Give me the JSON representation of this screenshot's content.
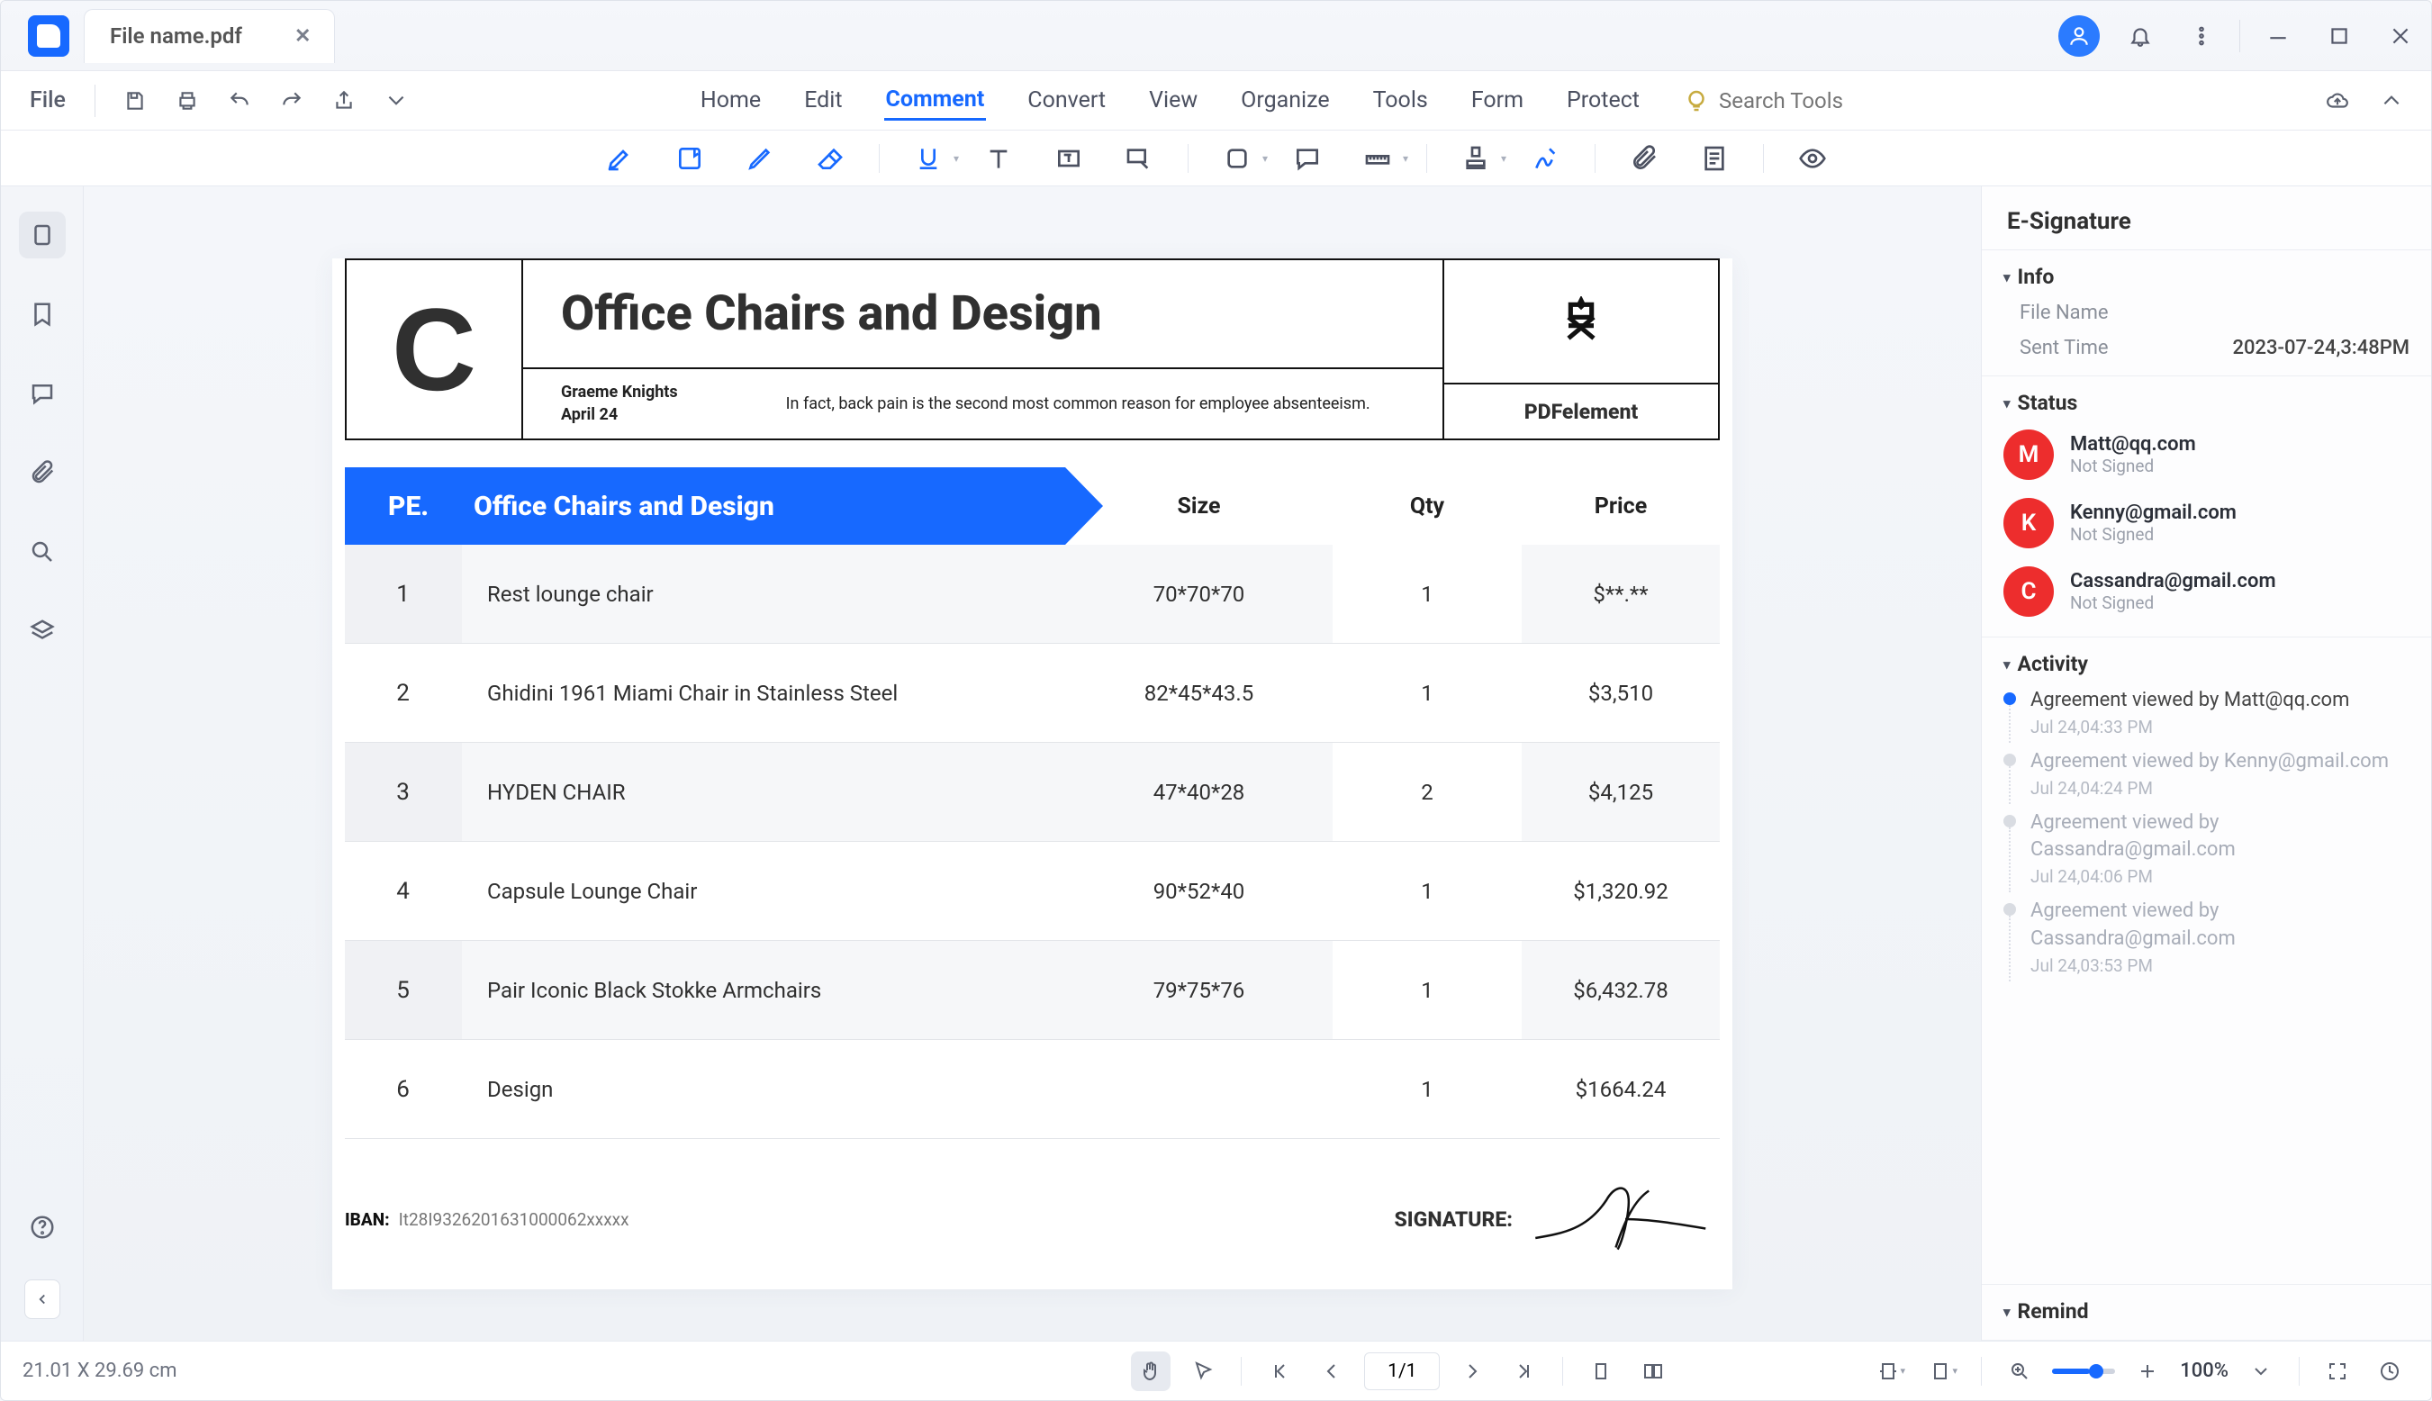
{
  "header": {
    "filename": "File name.pdf",
    "file_menu": "File"
  },
  "nav_items": [
    "Home",
    "Edit",
    "Comment",
    "Convert",
    "View",
    "Organize",
    "Tools",
    "Form",
    "Protect"
  ],
  "nav_active": "Comment",
  "search": {
    "placeholder": "Search Tools"
  },
  "leftbar_icons": [
    "thumbnails",
    "bookmarks",
    "comments",
    "attachments",
    "search",
    "layers"
  ],
  "document": {
    "title": "Office Chairs and Design",
    "author": "Graeme Knights",
    "date": "April 24",
    "subtitle": "In fact, back pain is the second most common reason for employee absenteeism.",
    "brand": "PDFelement",
    "pe_label": "PE.",
    "col_headers": {
      "size": "Size",
      "qty": "Qty",
      "price": "Price"
    },
    "rows": [
      {
        "no": "1",
        "name": "Rest lounge chair",
        "size": "70*70*70",
        "qty": "1",
        "price": "$**.**"
      },
      {
        "no": "2",
        "name": "Ghidini 1961 Miami Chair in Stainless Steel",
        "size": "82*45*43.5",
        "qty": "1",
        "price": "$3,510"
      },
      {
        "no": "3",
        "name": "HYDEN CHAIR",
        "size": "47*40*28",
        "qty": "2",
        "price": "$4,125"
      },
      {
        "no": "4",
        "name": "Capsule Lounge Chair",
        "size": "90*52*40",
        "qty": "1",
        "price": "$1,320.92"
      },
      {
        "no": "5",
        "name": "Pair Iconic Black Stokke Armchairs",
        "size": "79*75*76",
        "qty": "1",
        "price": "$6,432.78"
      },
      {
        "no": "6",
        "name": "Design",
        "size": "",
        "qty": "1",
        "price": "$1664.24"
      }
    ],
    "iban_label": "IBAN:",
    "iban_value": "It28I9326201631000062xxxxx",
    "signature_label": "SIGNATURE:"
  },
  "panel": {
    "title": "E-Signature",
    "info": {
      "label": "Info",
      "file_name_label": "File Name",
      "sent_time_label": "Sent Time",
      "sent_time": "2023-07-24,3:48PM"
    },
    "status": {
      "label": "Status",
      "signers": [
        {
          "initial": "M",
          "email": "Matt@qq.com",
          "status": "Not Signed"
        },
        {
          "initial": "K",
          "email": "Kenny@gmail.com",
          "status": "Not Signed"
        },
        {
          "initial": "C",
          "email": "Cassandra@gmail.com",
          "status": "Not Signed"
        }
      ]
    },
    "activity": {
      "label": "Activity",
      "items": [
        {
          "text": "Agreement viewed by Matt@qq.com",
          "ts": "Jul 24,04:33 PM",
          "active": true
        },
        {
          "text": "Agreement viewed by Kenny@gmail.com",
          "ts": "Jul 24,04:24 PM",
          "active": false
        },
        {
          "text": "Agreement viewed by Cassandra@gmail.com",
          "ts": "Jul 24,04:06 PM",
          "active": false
        },
        {
          "text": "Agreement viewed by Cassandra@gmail.com",
          "ts": "Jul 24,03:53 PM",
          "active": false
        }
      ]
    },
    "remind": {
      "label": "Remind"
    }
  },
  "status_bar": {
    "dimensions": "21.01 X 29.69 cm",
    "page": "1/1",
    "zoom": "100%"
  }
}
